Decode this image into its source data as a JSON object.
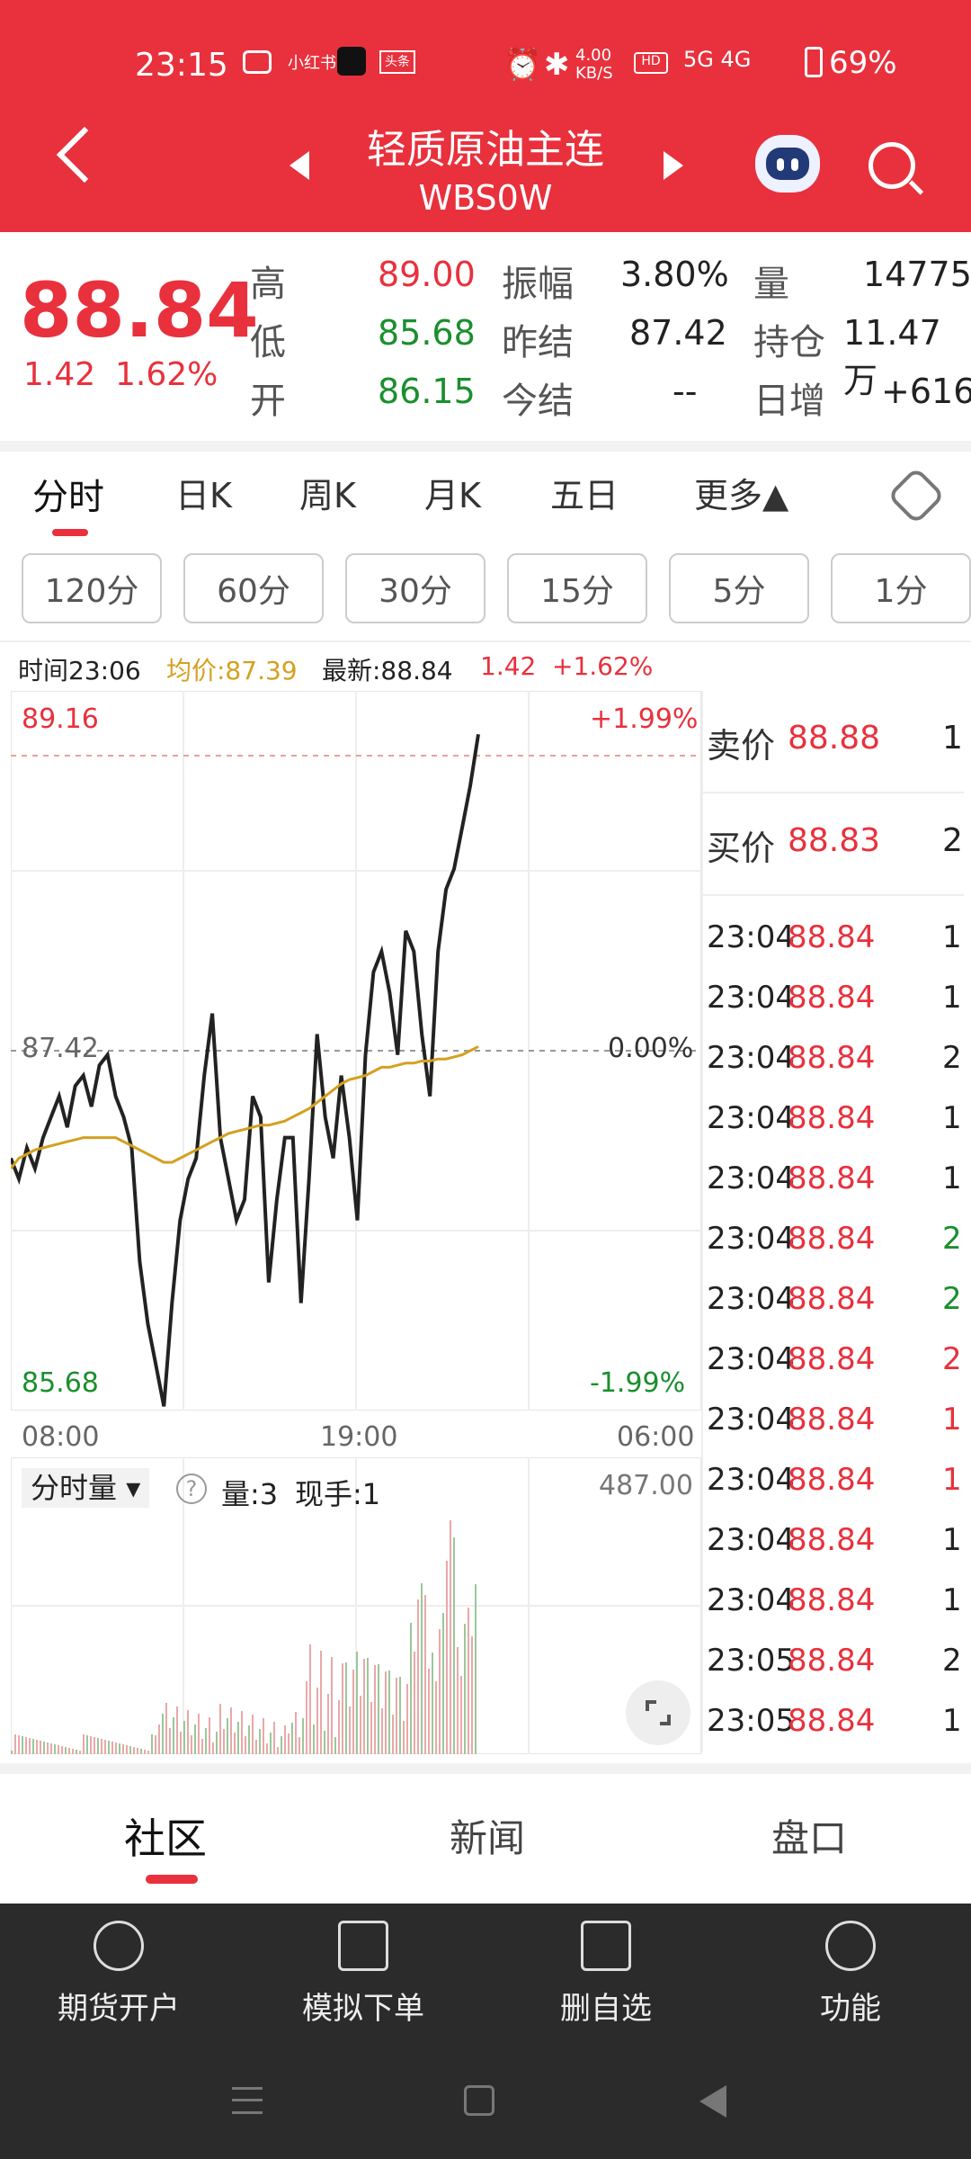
{
  "status_bar": {
    "time": "23:15",
    "battery": "69%",
    "net_speed": "4.00\nKB/S",
    "app_badges": [
      "mail",
      "小红书",
      "tiktok",
      "头条"
    ],
    "signal": "5G 4G"
  },
  "header": {
    "title": "轻质原油主连",
    "subtitle": "WBS0W"
  },
  "quote": {
    "price": "88.84",
    "change": "1.42",
    "change_pct": "1.62%",
    "high_label": "高",
    "high": "89.00",
    "low_label": "低",
    "low": "85.68",
    "open_label": "开",
    "open": "86.15",
    "amp_label": "振幅",
    "amp": "3.80%",
    "prev_settle_label": "昨结",
    "prev_settle": "87.42",
    "settle_label": "今结",
    "settle": "--",
    "vol_label": "量",
    "vol": "14775",
    "oi_label": "持仓",
    "oi": "11.47万",
    "daily_inc_label": "日增",
    "daily_inc": "+616"
  },
  "chart_tabs": [
    "分时",
    "日K",
    "周K",
    "月K",
    "五日",
    "更多▲"
  ],
  "period_pills": [
    "120分",
    "60分",
    "30分",
    "15分",
    "5分",
    "1分"
  ],
  "info_row": {
    "time": "时间23:06",
    "avg": "均价:87.39",
    "latest": "最新:88.84",
    "chg": "1.42",
    "chg_pct": "+1.62%"
  },
  "axis": {
    "top_price": "89.16",
    "top_pct": "+1.99%",
    "mid_price": "87.42",
    "mid_pct": "0.00%",
    "bot_price": "85.68",
    "bot_pct": "-1.99%",
    "x_start": "08:00",
    "x_mid": "19:00",
    "x_end": "06:00"
  },
  "volume_panel": {
    "label": "分时量",
    "vol": "量:3",
    "cur": "现手:1",
    "max": "487.00"
  },
  "order_book": [
    {
      "label": "卖价",
      "price": "88.88",
      "qty": "1"
    },
    {
      "label": "买价",
      "price": "88.83",
      "qty": "2"
    }
  ],
  "trades": [
    {
      "time": "23:04",
      "price": "88.84",
      "qty": "1",
      "qcolor": "#222"
    },
    {
      "time": "23:04",
      "price": "88.84",
      "qty": "1",
      "qcolor": "#222"
    },
    {
      "time": "23:04",
      "price": "88.84",
      "qty": "2",
      "qcolor": "#222"
    },
    {
      "time": "23:04",
      "price": "88.84",
      "qty": "1",
      "qcolor": "#222"
    },
    {
      "time": "23:04",
      "price": "88.84",
      "qty": "1",
      "qcolor": "#222"
    },
    {
      "time": "23:04",
      "price": "88.84",
      "qty": "2",
      "qcolor": "#1a8f2e"
    },
    {
      "time": "23:04",
      "price": "88.84",
      "qty": "2",
      "qcolor": "#1a8f2e"
    },
    {
      "time": "23:04",
      "price": "88.84",
      "qty": "2",
      "qcolor": "#e8313d"
    },
    {
      "time": "23:04",
      "price": "88.84",
      "qty": "1",
      "qcolor": "#e8313d"
    },
    {
      "time": "23:04",
      "price": "88.84",
      "qty": "1",
      "qcolor": "#e8313d"
    },
    {
      "time": "23:04",
      "price": "88.84",
      "qty": "1",
      "qcolor": "#222"
    },
    {
      "time": "23:04",
      "price": "88.84",
      "qty": "1",
      "qcolor": "#222"
    },
    {
      "time": "23:05",
      "price": "88.84",
      "qty": "2",
      "qcolor": "#222"
    },
    {
      "time": "23:05",
      "price": "88.84",
      "qty": "1",
      "qcolor": "#222"
    }
  ],
  "sub_tabs": [
    "社区",
    "新闻",
    "盘口"
  ],
  "bottom_nav": [
    {
      "label": "期货开户",
      "icon": "compass-icon"
    },
    {
      "label": "模拟下单",
      "icon": "document-icon"
    },
    {
      "label": "删自选",
      "icon": "minus-square-icon"
    },
    {
      "label": "功能",
      "icon": "menu-circle-icon"
    }
  ],
  "colors": {
    "brand": "#e8313d",
    "up": "#e8313d",
    "down": "#1a8f2e",
    "avg": "#d4a020"
  },
  "chart_data": {
    "type": "line",
    "title": "",
    "series": [
      {
        "name": "price",
        "values": [
          86.9,
          86.8,
          86.95,
          86.85,
          87.0,
          87.1,
          87.2,
          87.05,
          87.25,
          87.3,
          87.15,
          87.35,
          87.4,
          87.2,
          87.1,
          86.95,
          86.4,
          86.1,
          85.9,
          85.7,
          86.2,
          86.6,
          86.8,
          86.9,
          87.3,
          87.6,
          87.0,
          86.8,
          86.6,
          86.7,
          87.2,
          87.1,
          86.3,
          86.7,
          87.0,
          87.0,
          86.2,
          86.8,
          87.5,
          87.1,
          86.9,
          87.3,
          87.0,
          86.6,
          87.4,
          87.8,
          87.9,
          87.7,
          87.4,
          88.0,
          87.9,
          87.5,
          87.2,
          87.9,
          88.2,
          88.3,
          88.5,
          88.7,
          88.95
        ]
      },
      {
        "name": "avg",
        "values": [
          86.85,
          86.9,
          86.92,
          86.94,
          86.95,
          86.96,
          86.97,
          86.98,
          86.99,
          87.0,
          87.0,
          87.0,
          87.0,
          87.0,
          86.98,
          86.96,
          86.94,
          86.92,
          86.9,
          86.88,
          86.88,
          86.9,
          86.92,
          86.94,
          86.96,
          86.98,
          87.0,
          87.02,
          87.03,
          87.04,
          87.05,
          87.06,
          87.06,
          87.07,
          87.08,
          87.1,
          87.12,
          87.14,
          87.17,
          87.2,
          87.23,
          87.26,
          87.28,
          87.29,
          87.3,
          87.32,
          87.34,
          87.34,
          87.35,
          87.36,
          87.36,
          87.37,
          87.37,
          87.38,
          87.38,
          87.39,
          87.4,
          87.42,
          87.44
        ]
      }
    ],
    "ylim": [
      85.68,
      89.16
    ]
  }
}
